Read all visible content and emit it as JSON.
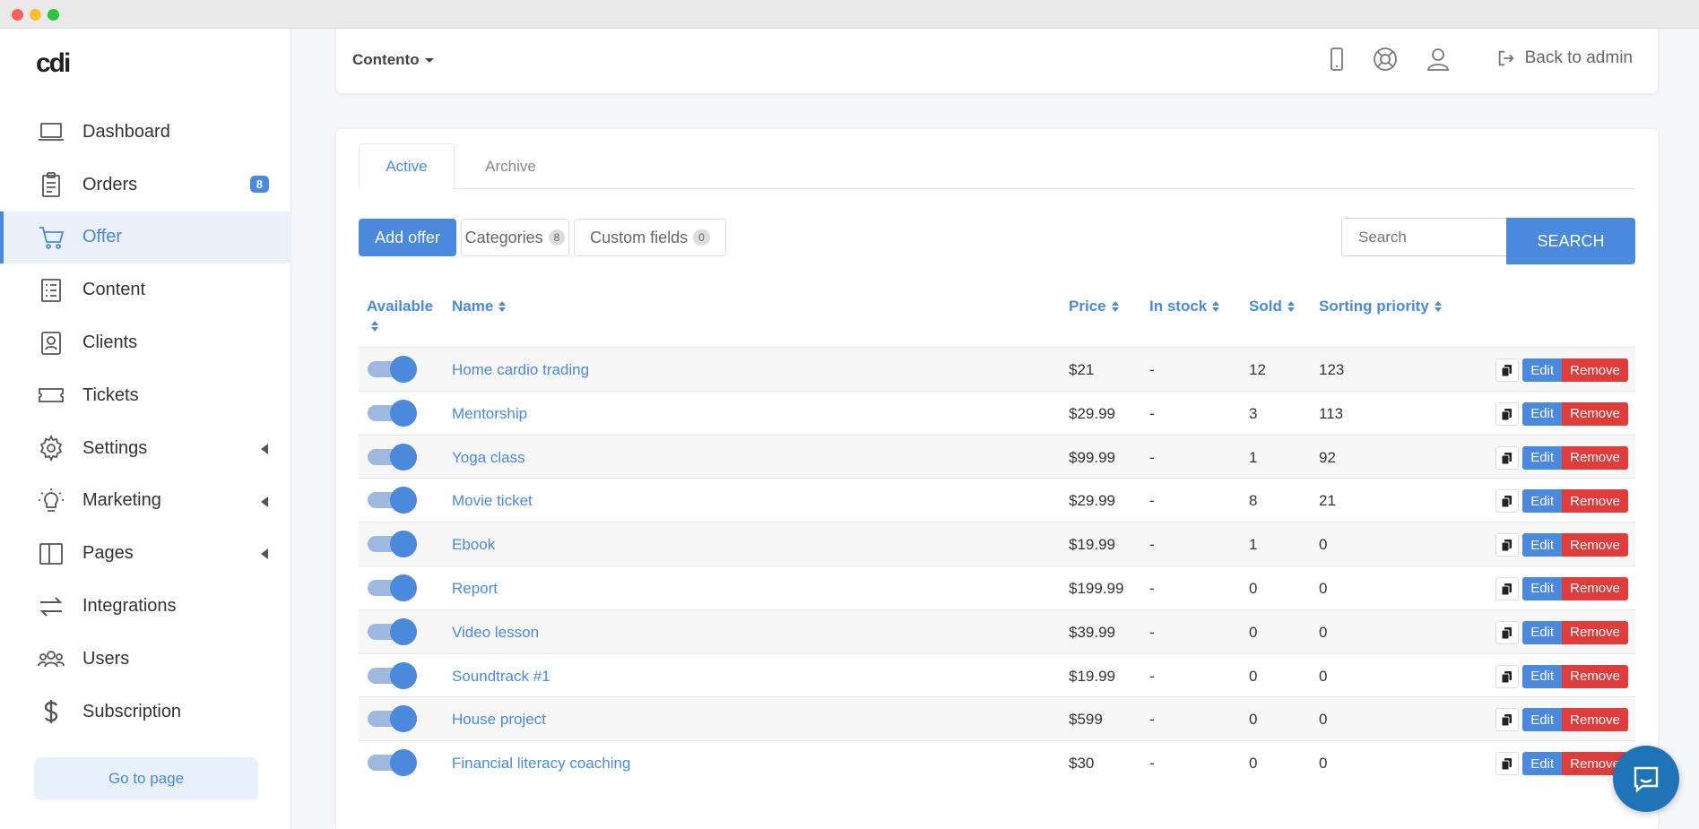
{
  "app": {
    "logo": "cdi"
  },
  "sidebar": {
    "items": [
      {
        "label": "Dashboard",
        "icon": "monitor-icon"
      },
      {
        "label": "Orders",
        "icon": "clipboard-icon",
        "badge": "8"
      },
      {
        "label": "Offer",
        "icon": "cart-icon",
        "active": true
      },
      {
        "label": "Content",
        "icon": "list-icon"
      },
      {
        "label": "Clients",
        "icon": "contacts-icon"
      },
      {
        "label": "Tickets",
        "icon": "ticket-icon"
      },
      {
        "label": "Settings",
        "icon": "gear-icon",
        "expandable": true
      },
      {
        "label": "Marketing",
        "icon": "lightbulb-icon",
        "expandable": true
      },
      {
        "label": "Pages",
        "icon": "layout-icon",
        "expandable": true
      },
      {
        "label": "Integrations",
        "icon": "arrows-icon"
      },
      {
        "label": "Users",
        "icon": "users-icon"
      },
      {
        "label": "Subscription",
        "icon": "dollar-icon"
      }
    ],
    "goto_label": "Go to page"
  },
  "topbar": {
    "project": "Contento",
    "back_label": "Back to admin"
  },
  "tabs": {
    "active": "Active",
    "archive": "Archive"
  },
  "toolbar": {
    "add_label": "Add offer",
    "categories_label": "Categories",
    "categories_count": "8",
    "custom_fields_label": "Custom fields",
    "custom_fields_count": "0",
    "search_placeholder": "Search",
    "search_button": "SEARCH"
  },
  "table": {
    "headers": {
      "available": "Available",
      "name": "Name",
      "price": "Price",
      "stock": "In stock",
      "sold": "Sold",
      "priority": "Sorting priority"
    },
    "edit_label": "Edit",
    "remove_label": "Remove",
    "rows": [
      {
        "name": "Home cardio trading",
        "price": "$21",
        "stock": "-",
        "sold": "12",
        "priority": "123"
      },
      {
        "name": "Mentorship",
        "price": "$29.99",
        "stock": "-",
        "sold": "3",
        "priority": "113"
      },
      {
        "name": "Yoga class",
        "price": "$99.99",
        "stock": "-",
        "sold": "1",
        "priority": "92"
      },
      {
        "name": "Movie ticket",
        "price": "$29.99",
        "stock": "-",
        "sold": "8",
        "priority": "21"
      },
      {
        "name": "Ebook",
        "price": "$19.99",
        "stock": "-",
        "sold": "1",
        "priority": "0"
      },
      {
        "name": "Report",
        "price": "$199.99",
        "stock": "-",
        "sold": "0",
        "priority": "0"
      },
      {
        "name": "Video lesson",
        "price": "$39.99",
        "stock": "-",
        "sold": "0",
        "priority": "0"
      },
      {
        "name": "Soundtrack #1",
        "price": "$19.99",
        "stock": "-",
        "sold": "0",
        "priority": "0"
      },
      {
        "name": "House project",
        "price": "$599",
        "stock": "-",
        "sold": "0",
        "priority": "0"
      },
      {
        "name": "Financial literacy coaching",
        "price": "$30",
        "stock": "-",
        "sold": "0",
        "priority": "0"
      }
    ]
  },
  "colors": {
    "accent": "#4a89dc",
    "danger": "#e03c3c",
    "chat": "#1f73b7"
  }
}
